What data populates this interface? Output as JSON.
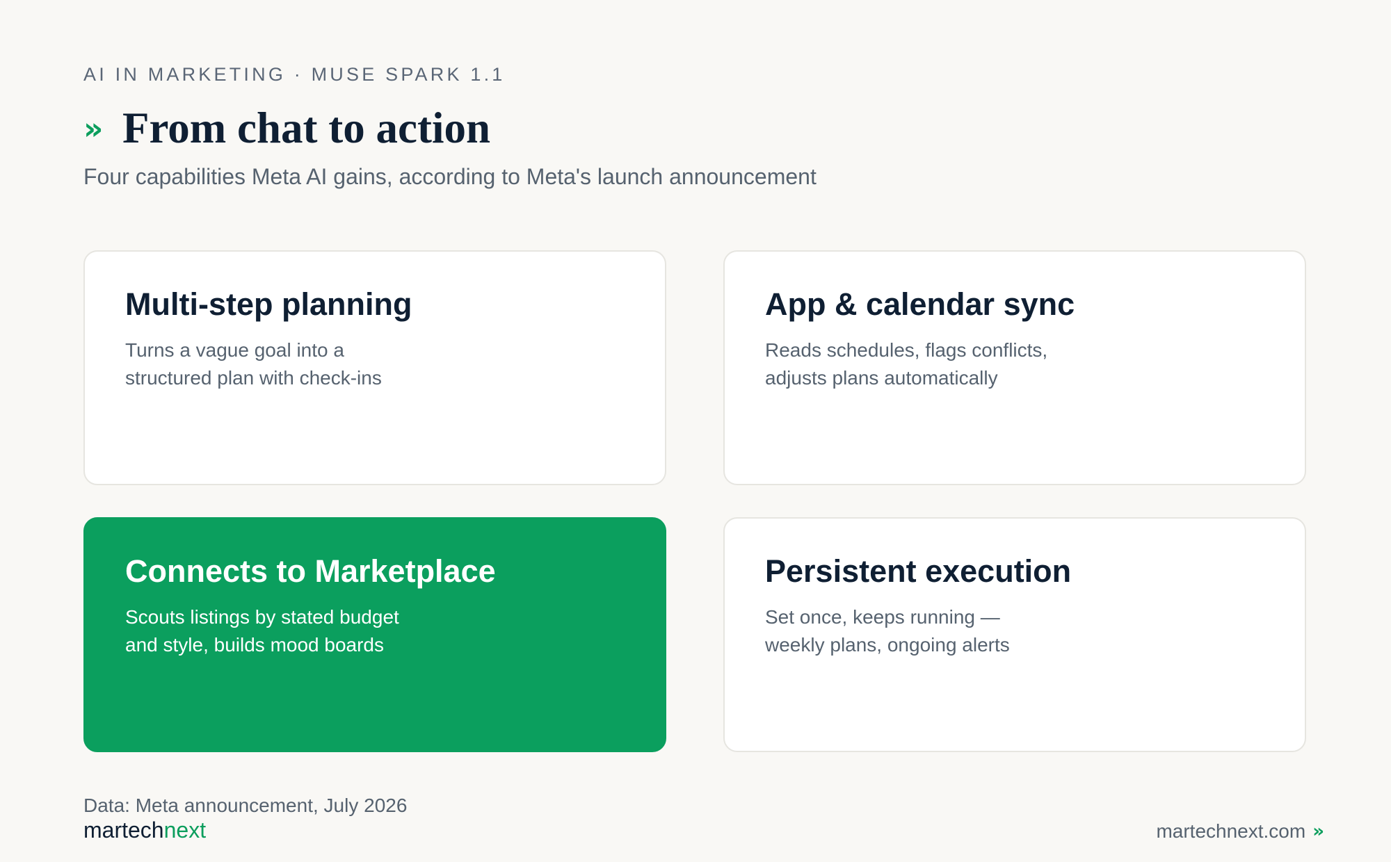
{
  "header": {
    "eyebrow": "AI IN MARKETING · MUSE SPARK 1.1",
    "title_icon": "»",
    "title": "From chat to action",
    "subtitle": "Four capabilities Meta AI gains, according to Meta's launch announcement"
  },
  "cards": [
    {
      "title": "Multi-step planning",
      "desc_line1": "Turns a vague goal into a",
      "desc_line2": "structured plan with check-ins",
      "highlight": false
    },
    {
      "title": "App & calendar sync",
      "desc_line1": "Reads schedules, flags conflicts,",
      "desc_line2": "adjusts plans automatically",
      "highlight": false
    },
    {
      "title": "Connects to Marketplace",
      "desc_line1": "Scouts listings by stated budget",
      "desc_line2": "and style, builds mood boards",
      "highlight": true
    },
    {
      "title": "Persistent execution",
      "desc_line1": "Set once, keeps running —",
      "desc_line2": "weekly plans, ongoing alerts",
      "highlight": false
    }
  ],
  "footer": {
    "source": "Data: Meta announcement, July 2026",
    "brand_part1": "martech",
    "brand_part2": "next",
    "site": "martechnext.com",
    "site_icon": "»"
  },
  "colors": {
    "background": "#f9f8f5",
    "accent_green": "#0b9f5e",
    "text_dark": "#0f1f33",
    "text_muted": "#56626f"
  }
}
